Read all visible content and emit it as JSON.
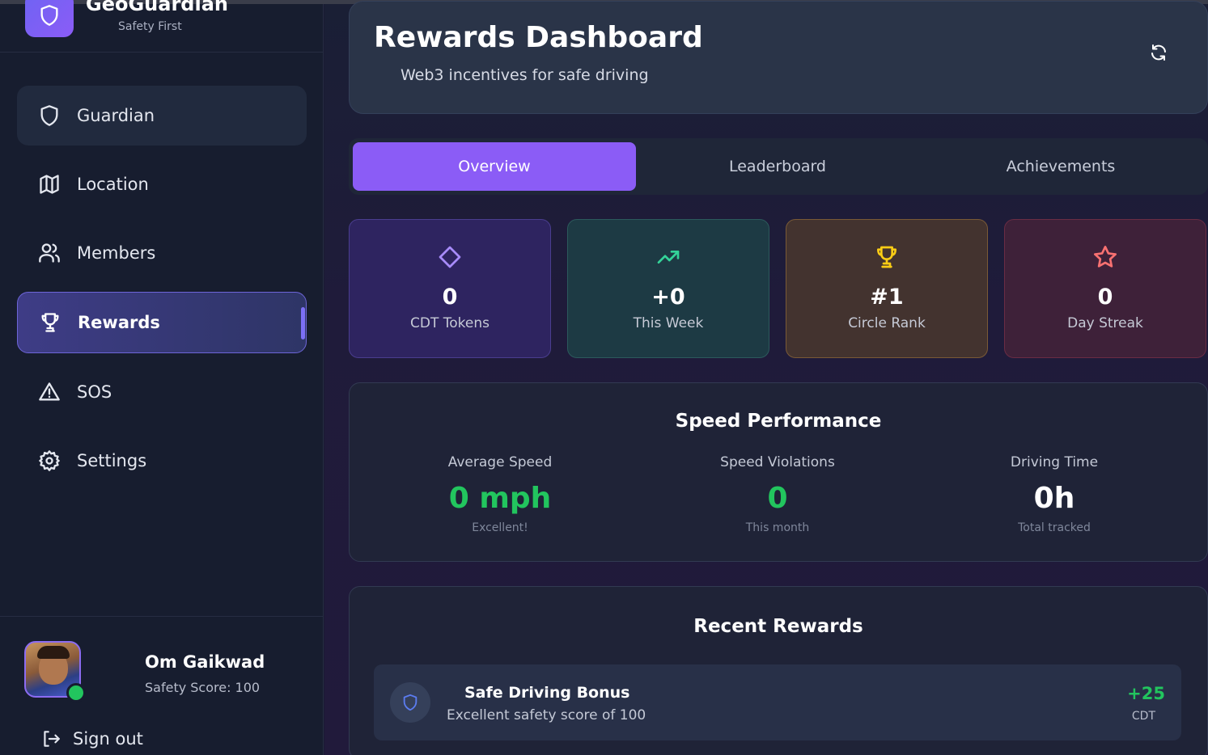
{
  "brand": {
    "name": "GeoGuardian",
    "tagline": "Safety First"
  },
  "sidebar": {
    "items": [
      {
        "label": "Guardian",
        "icon": "shield-icon"
      },
      {
        "label": "Location",
        "icon": "map-icon"
      },
      {
        "label": "Members",
        "icon": "users-icon"
      },
      {
        "label": "Rewards",
        "icon": "trophy-icon",
        "active": true
      },
      {
        "label": "SOS",
        "icon": "alert-triangle-icon"
      },
      {
        "label": "Settings",
        "icon": "gear-icon"
      }
    ]
  },
  "user": {
    "name": "Om Gaikwad",
    "score": "Safety Score: 100",
    "status": "online"
  },
  "signout": {
    "label": "Sign out"
  },
  "header": {
    "title": "Rewards Dashboard",
    "subtitle": "Web3 incentives for safe driving"
  },
  "tabs": [
    {
      "label": "Overview",
      "active": true
    },
    {
      "label": "Leaderboard"
    },
    {
      "label": "Achievements"
    }
  ],
  "stats": [
    {
      "value": "0",
      "label": "CDT Tokens",
      "icon": "diamond-icon",
      "color": "#a78bfa"
    },
    {
      "value": "+0",
      "label": "This Week",
      "icon": "trending-up-icon",
      "color": "#34d399"
    },
    {
      "value": "#1",
      "label": "Circle Rank",
      "icon": "trophy-icon",
      "color": "#facc15"
    },
    {
      "value": "0",
      "label": "Day Streak",
      "icon": "star-icon",
      "color": "#f87171"
    }
  ],
  "speed": {
    "title": "Speed Performance",
    "metrics": [
      {
        "label": "Average Speed",
        "value": "0 mph",
        "sub": "Excellent!"
      },
      {
        "label": "Speed Violations",
        "value": "0",
        "sub": "This month"
      },
      {
        "label": "Driving Time",
        "value": "0h",
        "sub": "Total tracked"
      }
    ]
  },
  "recent": {
    "title": "Recent Rewards",
    "items": [
      {
        "name": "Safe Driving Bonus",
        "description": "Excellent safety score of 100",
        "amount": "+25",
        "unit": "CDT",
        "icon": "shield-icon"
      }
    ]
  },
  "colors": {
    "accent": "#8b5cf6",
    "success": "#22c55e"
  }
}
